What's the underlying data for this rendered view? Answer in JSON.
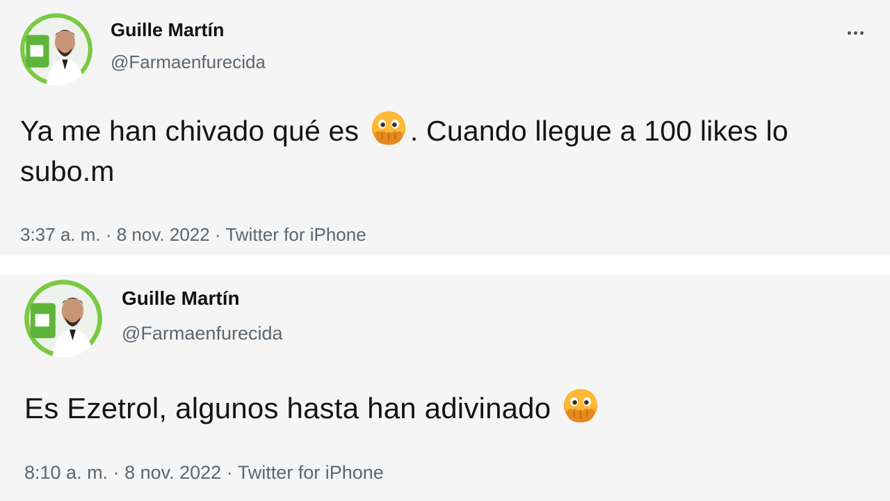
{
  "tweets": [
    {
      "author": {
        "display_name": "Guille Martín",
        "handle": "@Farmaenfurecida",
        "avatar_icon": "profile-photo"
      },
      "more_icon": "more-horizontal-icon",
      "text_before_emoji": "Ya me han chivado qué es ",
      "emoji": "face-with-open-eyes-and-hand-over-mouth",
      "text_after_emoji": ". Cuando llegue a 100 likes lo subo.m",
      "time": "3:37 a. m.",
      "date": "8 nov. 2022",
      "source": "Twitter for iPhone",
      "separator": " · "
    },
    {
      "author": {
        "display_name": "Guille Martín",
        "handle": "@Farmaenfurecida",
        "avatar_icon": "profile-photo"
      },
      "text_before_emoji": "Es Ezetrol, algunos hasta han adivinado ",
      "emoji": "face-with-open-eyes-and-hand-over-mouth",
      "text_after_emoji": "",
      "time": "8:10 a. m.",
      "date": "8 nov. 2022",
      "source": "Twitter for iPhone",
      "separator": " · "
    }
  ],
  "colors": {
    "card_background": "#f5f5f5",
    "page_background": "#ffffff",
    "text": "#141414",
    "secondary_text": "#5b6670",
    "avatar_ring": "#7ac943",
    "emoji": "#f5a623"
  }
}
